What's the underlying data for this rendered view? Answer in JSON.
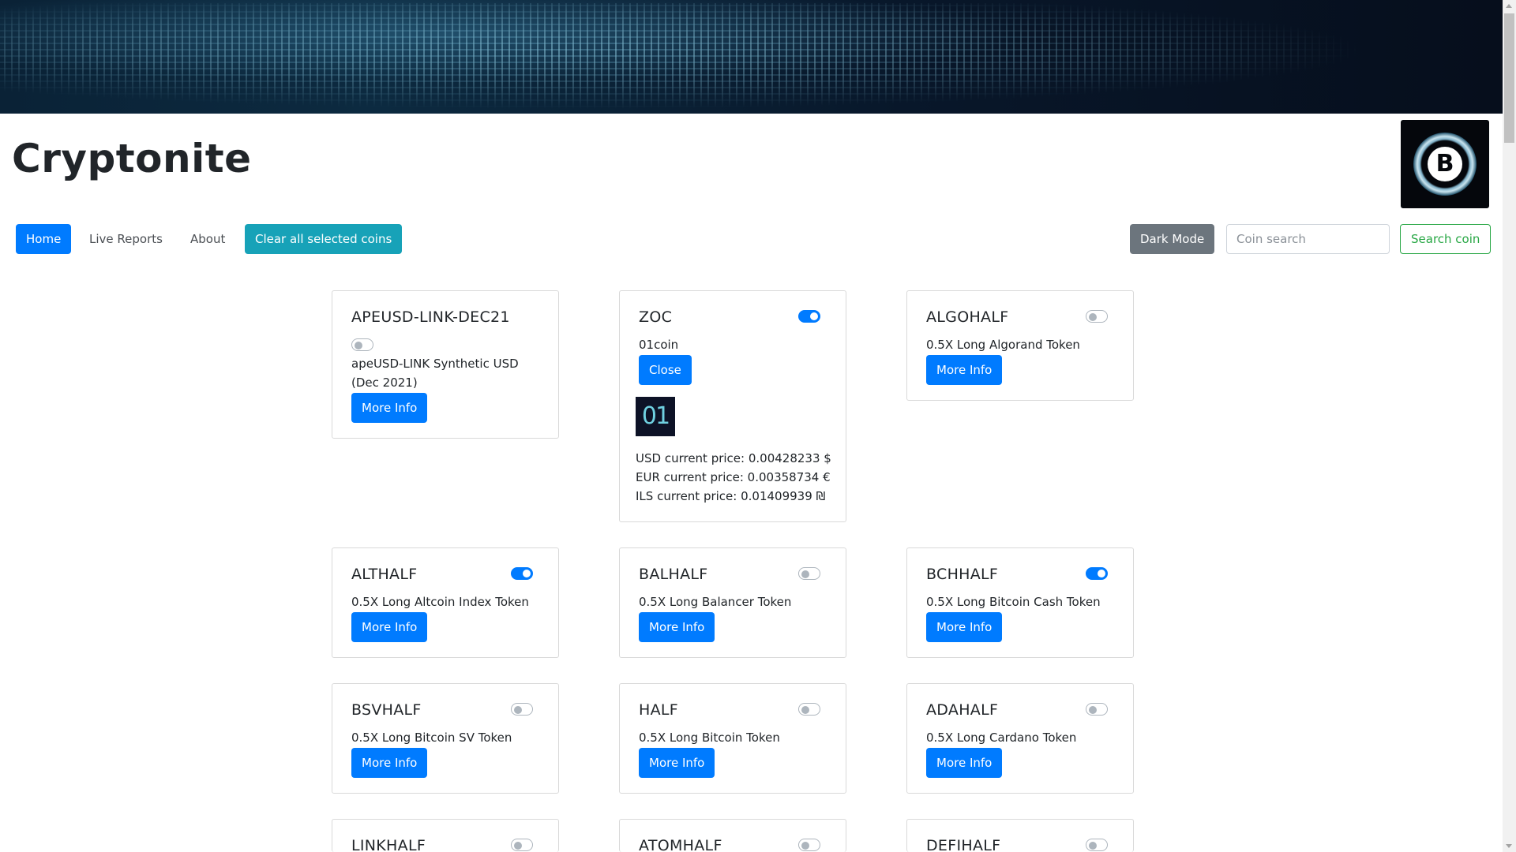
{
  "site": {
    "title": "Cryptonite",
    "logo_icon": "bitcoin-cash-logo-icon",
    "logo_glyph": "B"
  },
  "nav": {
    "home": "Home",
    "live_reports": "Live Reports",
    "about": "About",
    "clear_all": "Clear all selected coins",
    "dark_mode": "Dark Mode",
    "search_placeholder": "Coin search",
    "search_button": "Search coin"
  },
  "colors": {
    "primary": "#007bff",
    "info": "#17a2b8",
    "secondary": "#6c757d",
    "success": "#28a745"
  },
  "cards": [
    {
      "symbol": "APEUSD-LINK-DEC21",
      "name": "apeUSD-LINK Synthetic USD (Dec 2021)",
      "selected": false,
      "button": "More Info"
    },
    {
      "symbol": "ZOC",
      "name": "01coin",
      "selected": true,
      "button": "Close",
      "image_text": "01",
      "prices": {
        "usd": "USD current price: 0.00428233 $",
        "eur": "EUR current price: 0.00358734 €",
        "ils": "ILS current price: 0.01409939 ₪"
      }
    },
    {
      "symbol": "ALGOHALF",
      "name": "0.5X Long Algorand Token",
      "selected": false,
      "button": "More Info"
    },
    {
      "symbol": "ALTHALF",
      "name": "0.5X Long Altcoin Index Token",
      "selected": true,
      "button": "More Info"
    },
    {
      "symbol": "BALHALF",
      "name": "0.5X Long Balancer Token",
      "selected": false,
      "button": "More Info"
    },
    {
      "symbol": "BCHHALF",
      "name": "0.5X Long Bitcoin Cash Token",
      "selected": true,
      "button": "More Info"
    },
    {
      "symbol": "BSVHALF",
      "name": "0.5X Long Bitcoin SV Token",
      "selected": false,
      "button": "More Info"
    },
    {
      "symbol": "HALF",
      "name": "0.5X Long Bitcoin Token",
      "selected": false,
      "button": "More Info"
    },
    {
      "symbol": "ADAHALF",
      "name": "0.5X Long Cardano Token",
      "selected": false,
      "button": "More Info"
    },
    {
      "symbol": "LINKHALF",
      "selected": false
    },
    {
      "symbol": "ATOMHALF",
      "selected": false
    },
    {
      "symbol": "DEFIHALF",
      "selected": false
    }
  ]
}
